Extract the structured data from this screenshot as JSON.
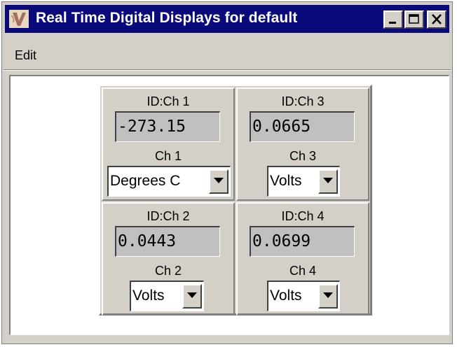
{
  "window": {
    "title": "Real Time Digital Displays for default",
    "colors": {
      "titlebar": "#0a0a7a",
      "face": "#d4d0c8",
      "readout_bg": "#c0c0c0"
    }
  },
  "menu": {
    "edit": "Edit"
  },
  "channels": [
    {
      "id_label": "ID:Ch 1",
      "value": "-273.15",
      "name": "Ch 1",
      "unit": "Degrees C"
    },
    {
      "id_label": "ID:Ch 3",
      "value": "0.0665",
      "name": "Ch 3",
      "unit": "Volts"
    },
    {
      "id_label": "ID:Ch 2",
      "value": "0.0443",
      "name": "Ch 2",
      "unit": "Volts"
    },
    {
      "id_label": "ID:Ch 4",
      "value": "0.0699",
      "name": "Ch 4",
      "unit": "Volts"
    }
  ],
  "icons": {
    "app": "app-logo-icon",
    "minimize": "minimize-icon",
    "maximize": "maximize-icon",
    "close": "close-icon",
    "dropdown": "chevron-down-icon"
  }
}
